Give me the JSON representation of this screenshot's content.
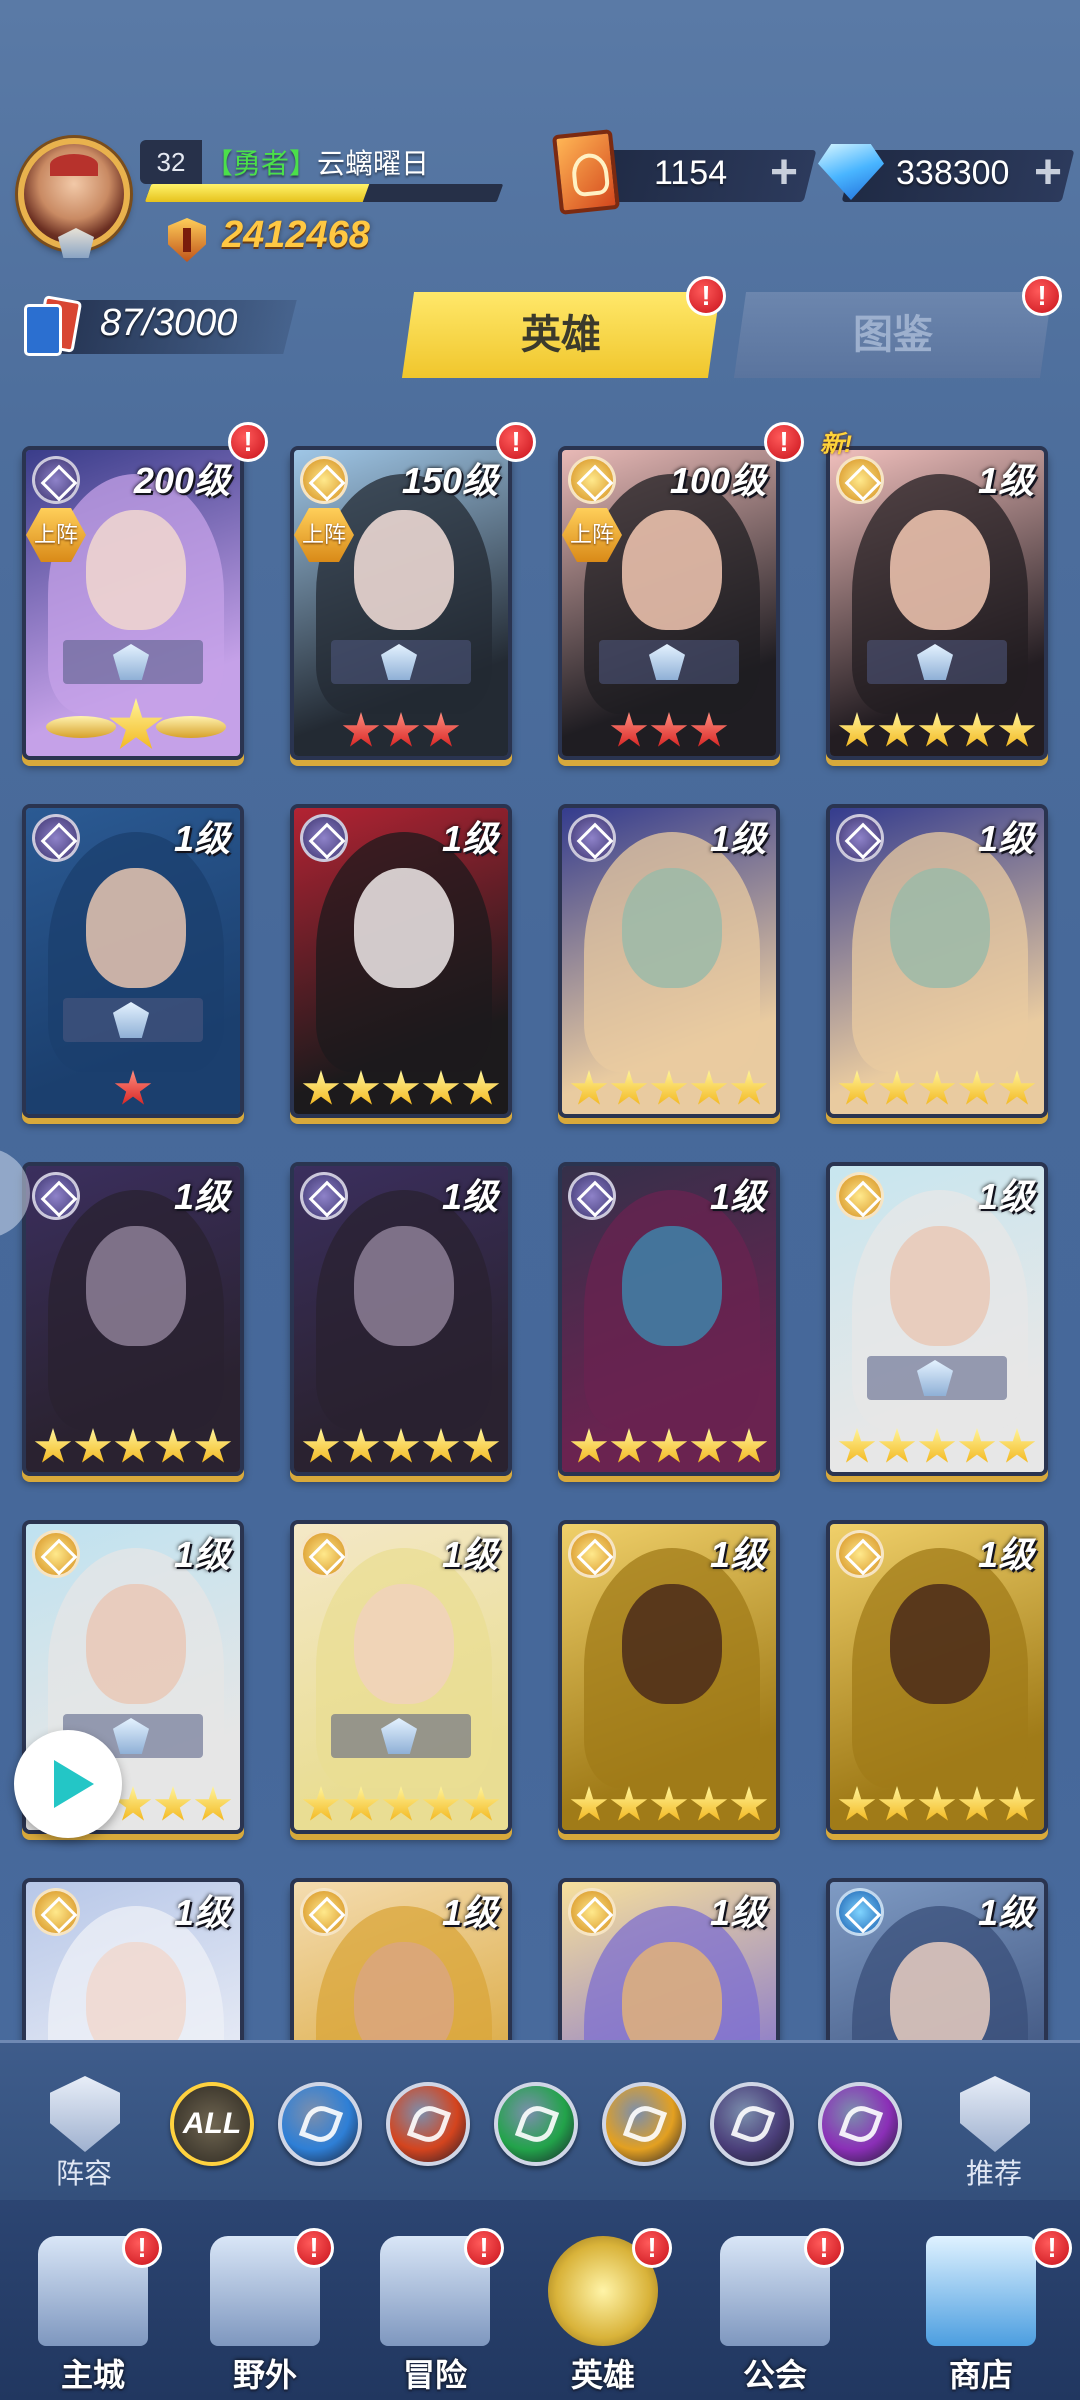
{
  "header": {
    "player_level": "32",
    "rank_tag": "【勇者】",
    "player_name": "云螭曜日",
    "xp_fraction": 0.62,
    "power": "2412468",
    "scrolls": "1154",
    "gems": "338300",
    "plus_glyph": "+"
  },
  "heroes_count": "87/3000",
  "tabs": [
    {
      "label": "英雄",
      "active": true
    },
    {
      "label": "图鉴",
      "active": false
    }
  ],
  "badge_glyph": "!",
  "new_label": "新!",
  "deploy_label": "上阵",
  "heroes": [
    {
      "level": "200级",
      "faction": "purple",
      "deployed": true,
      "stars": "wing",
      "badge": true,
      "colors": [
        "#3a3d8a",
        "#c5a1e8",
        "#f1d7cf"
      ]
    },
    {
      "level": "150级",
      "faction": "gold",
      "deployed": true,
      "stars": "red3",
      "badge": true,
      "colors": [
        "#9fc6e6",
        "#232a33",
        "#f6e0da"
      ]
    },
    {
      "level": "100级",
      "faction": "gold",
      "deployed": true,
      "stars": "red3",
      "badge": true,
      "colors": [
        "#e8b9b6",
        "#1f1d22",
        "#f3c8b3"
      ]
    },
    {
      "level": "1级",
      "faction": "gold",
      "deployed": false,
      "new": true,
      "stars": "gold5",
      "badge": false,
      "colors": [
        "#f0bfbc",
        "#231d22",
        "#f3c8b3"
      ]
    },
    {
      "level": "1级",
      "faction": "purple",
      "stars": "red1",
      "colors": [
        "#2b5a93",
        "#1b3f6e",
        "#e8c6b0"
      ]
    },
    {
      "level": "1级",
      "faction": "purple",
      "stars": "gold5",
      "colors": [
        "#b32333",
        "#1c1a1c",
        "#f0eaea"
      ]
    },
    {
      "level": "1级",
      "faction": "purple",
      "stars": "gold5",
      "colors": [
        "#343c8e",
        "#e9cba0",
        "#9bbaa8"
      ]
    },
    {
      "level": "1级",
      "faction": "purple",
      "stars": "gold5",
      "colors": [
        "#343c8e",
        "#e9cba0",
        "#9bbaa8"
      ]
    },
    {
      "level": "1级",
      "faction": "purple",
      "stars": "gold5",
      "colors": [
        "#3b2f5e",
        "#2a2230",
        "#8d7f96"
      ]
    },
    {
      "level": "1级",
      "faction": "purple",
      "stars": "gold5",
      "colors": [
        "#3b2f5e",
        "#2a2230",
        "#8d7f96"
      ]
    },
    {
      "level": "1级",
      "faction": "purple",
      "stars": "gold5",
      "colors": [
        "#35304a",
        "#6a2350",
        "#3f83a8"
      ]
    },
    {
      "level": "1级",
      "faction": "gold",
      "stars": "gold5",
      "colors": [
        "#c7e6ef",
        "#e7e7e7",
        "#e9c8b6"
      ]
    },
    {
      "level": "1级",
      "faction": "gold",
      "stars": "gold5",
      "colors": [
        "#bfe2f0",
        "#e6e6e6",
        "#e9c8b6"
      ]
    },
    {
      "level": "1级",
      "faction": "gold",
      "stars": "gold5",
      "colors": [
        "#f4e8c7",
        "#e9dd93",
        "#f1d2bc"
      ]
    },
    {
      "level": "1级",
      "faction": "gold",
      "stars": "gold5",
      "colors": [
        "#f0d06a",
        "#a07b18",
        "#4a2a1a"
      ]
    },
    {
      "level": "1级",
      "faction": "gold",
      "stars": "gold5",
      "colors": [
        "#f0d06a",
        "#a07b18",
        "#4a2a1a"
      ]
    },
    {
      "level": "1级",
      "faction": "gold",
      "stars": "gold5",
      "colors": [
        "#b7c7e8",
        "#eef0f7",
        "#f0d8cf"
      ]
    },
    {
      "level": "1级",
      "faction": "gold",
      "stars": "gold5",
      "colors": [
        "#f4dcb0",
        "#d9a63a",
        "#dba67f"
      ]
    },
    {
      "level": "1级",
      "faction": "gold",
      "stars": "gold5",
      "colors": [
        "#f7e09c",
        "#7e6fd0",
        "#e0b27a"
      ]
    },
    {
      "level": "1级",
      "faction": "blue",
      "stars": "gold5",
      "colors": [
        "#7f9bc4",
        "#3a4f7a",
        "#e7cdbf"
      ]
    }
  ],
  "filters": [
    {
      "label": "ALL",
      "color": "#6f6551",
      "active": true
    },
    {
      "icon": "water-icon",
      "color": "#2e7fd6"
    },
    {
      "icon": "fire-icon",
      "color": "#d4441e"
    },
    {
      "icon": "wind-icon",
      "color": "#22a34a"
    },
    {
      "icon": "light-icon",
      "color": "#e3a021"
    },
    {
      "icon": "dark-icon",
      "color": "#4b3f7a"
    },
    {
      "icon": "chaos-icon",
      "color": "#8b2fb7"
    }
  ],
  "side_buttons": {
    "lineup": "阵容",
    "recommend": "推荐"
  },
  "nav": [
    {
      "label": "主城",
      "badge": true
    },
    {
      "label": "野外",
      "badge": true
    },
    {
      "label": "冒险",
      "badge": true
    },
    {
      "label": "英雄",
      "badge": true,
      "active": true
    },
    {
      "label": "公会",
      "badge": true
    },
    {
      "label": "商店",
      "badge": true
    }
  ]
}
